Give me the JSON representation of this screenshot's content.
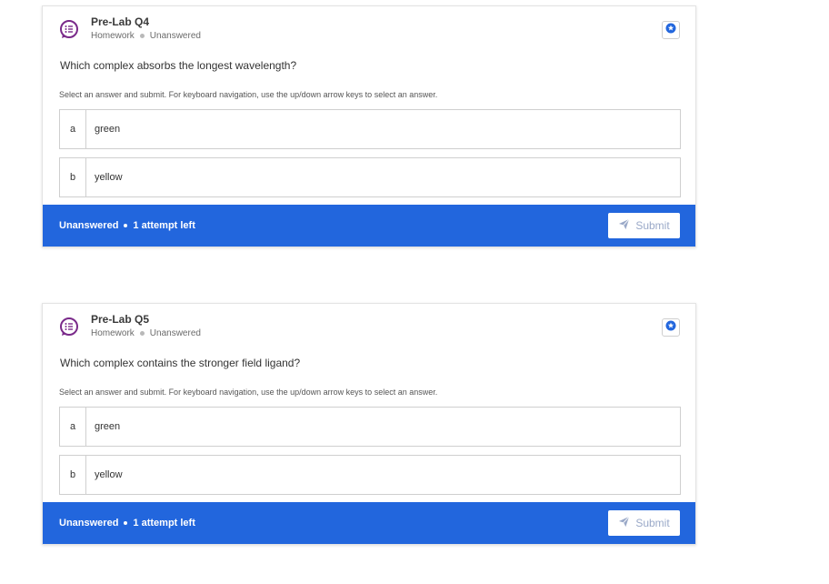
{
  "colors": {
    "accent": "#2266dd",
    "icon_purple": "#7a2a8a",
    "submit_disabled": "#9aa9c8"
  },
  "cards": [
    {
      "title": "Pre-Lab Q4",
      "type": "Homework",
      "status": "Unanswered",
      "question": "Which complex absorbs the longest wavelength?",
      "instructions": "Select an answer and submit. For keyboard navigation, use the up/down arrow keys to select an answer.",
      "options": [
        {
          "letter": "a",
          "text": "green"
        },
        {
          "letter": "b",
          "text": "yellow"
        }
      ],
      "footer_status": "Unanswered",
      "attempts": "1 attempt left",
      "submit_label": "Submit",
      "icon": "question-list-icon",
      "bookmark_icon": "star-badge-icon"
    },
    {
      "title": "Pre-Lab Q5",
      "type": "Homework",
      "status": "Unanswered",
      "question": "Which complex contains the stronger field ligand?",
      "instructions": "Select an answer and submit. For keyboard navigation, use the up/down arrow keys to select an answer.",
      "options": [
        {
          "letter": "a",
          "text": "green"
        },
        {
          "letter": "b",
          "text": "yellow"
        }
      ],
      "footer_status": "Unanswered",
      "attempts": "1 attempt left",
      "submit_label": "Submit",
      "icon": "question-list-icon",
      "bookmark_icon": "star-badge-icon"
    }
  ]
}
